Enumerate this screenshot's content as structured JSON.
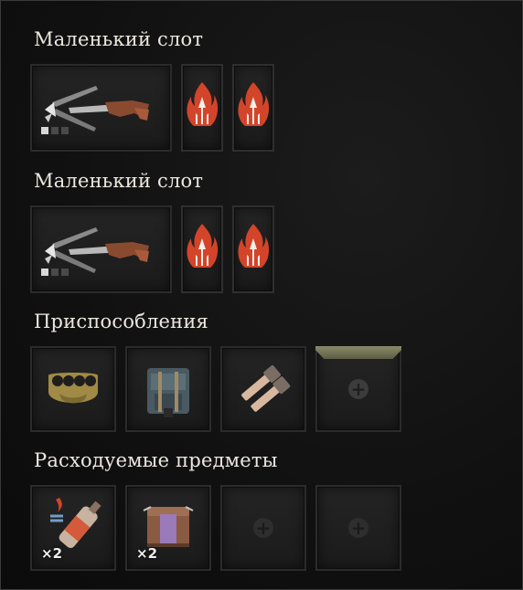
{
  "sections": [
    {
      "title": "Маленький слот"
    },
    {
      "title": "Маленький слот"
    },
    {
      "title": "Приспособления"
    },
    {
      "title": "Расходуемые предметы"
    }
  ],
  "weapon_slots": [
    {
      "item_icon": "crossbow-icon",
      "upgrade_level": 1,
      "upgrade_max": 3,
      "ammo": [
        "fire-bolt-icon",
        "fire-bolt-icon"
      ]
    },
    {
      "item_icon": "crossbow-icon",
      "upgrade_level": 1,
      "upgrade_max": 3,
      "ammo": [
        "fire-bolt-icon",
        "fire-bolt-icon"
      ]
    }
  ],
  "gadgets": [
    {
      "icon": "brass-knuckles-icon"
    },
    {
      "icon": "backpack-icon"
    },
    {
      "icon": "stun-grenades-icon"
    },
    {
      "icon": "add-icon",
      "empty": true
    }
  ],
  "consumables": [
    {
      "icon": "fire-bottle-icon",
      "count": "×2"
    },
    {
      "icon": "explosive-crate-icon",
      "count": "×2"
    },
    {
      "icon": "add-icon",
      "empty": true
    },
    {
      "icon": "add-icon",
      "empty": true
    }
  ],
  "add_glyph": "+",
  "colors": {
    "fire": "#d2452a",
    "bolt": "#f4f0ea",
    "slot_bg": "#222222",
    "accent_tab": "#7d7d5e"
  }
}
